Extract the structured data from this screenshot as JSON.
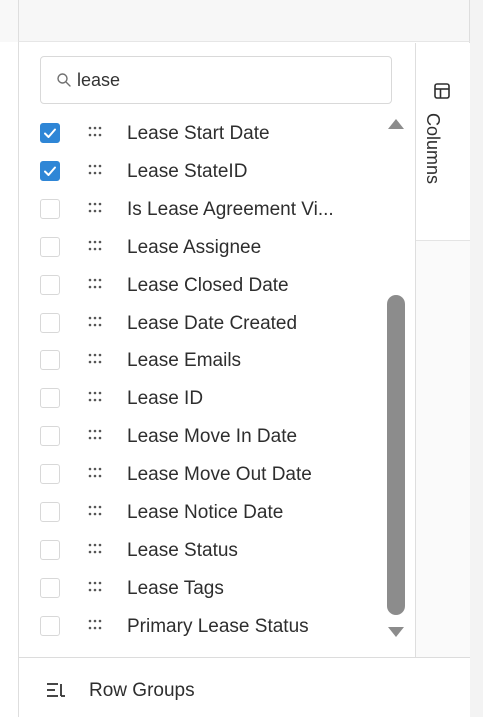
{
  "search": {
    "value": "lease",
    "icon": "search-icon"
  },
  "side_tab": {
    "label": "Columns",
    "icon": "columns-icon"
  },
  "columns": [
    {
      "label": "Lease Start Date",
      "checked": true
    },
    {
      "label": "Lease StateID",
      "checked": true
    },
    {
      "label": "Is Lease Agreement Vi...",
      "checked": false
    },
    {
      "label": "Lease Assignee",
      "checked": false
    },
    {
      "label": "Lease Closed Date",
      "checked": false
    },
    {
      "label": "Lease Date Created",
      "checked": false
    },
    {
      "label": "Lease Emails",
      "checked": false
    },
    {
      "label": "Lease ID",
      "checked": false
    },
    {
      "label": "Lease Move In Date",
      "checked": false
    },
    {
      "label": "Lease Move Out Date",
      "checked": false
    },
    {
      "label": "Lease Notice Date",
      "checked": false
    },
    {
      "label": "Lease Status",
      "checked": false
    },
    {
      "label": "Lease Tags",
      "checked": false
    },
    {
      "label": "Primary Lease Status",
      "checked": false
    }
  ],
  "row_groups": {
    "label": "Row Groups",
    "icon": "row-groups-icon"
  },
  "colors": {
    "checkbox_checked": "#2f86d6",
    "scrollbar": "#8c8c8c",
    "border": "#dedede"
  }
}
